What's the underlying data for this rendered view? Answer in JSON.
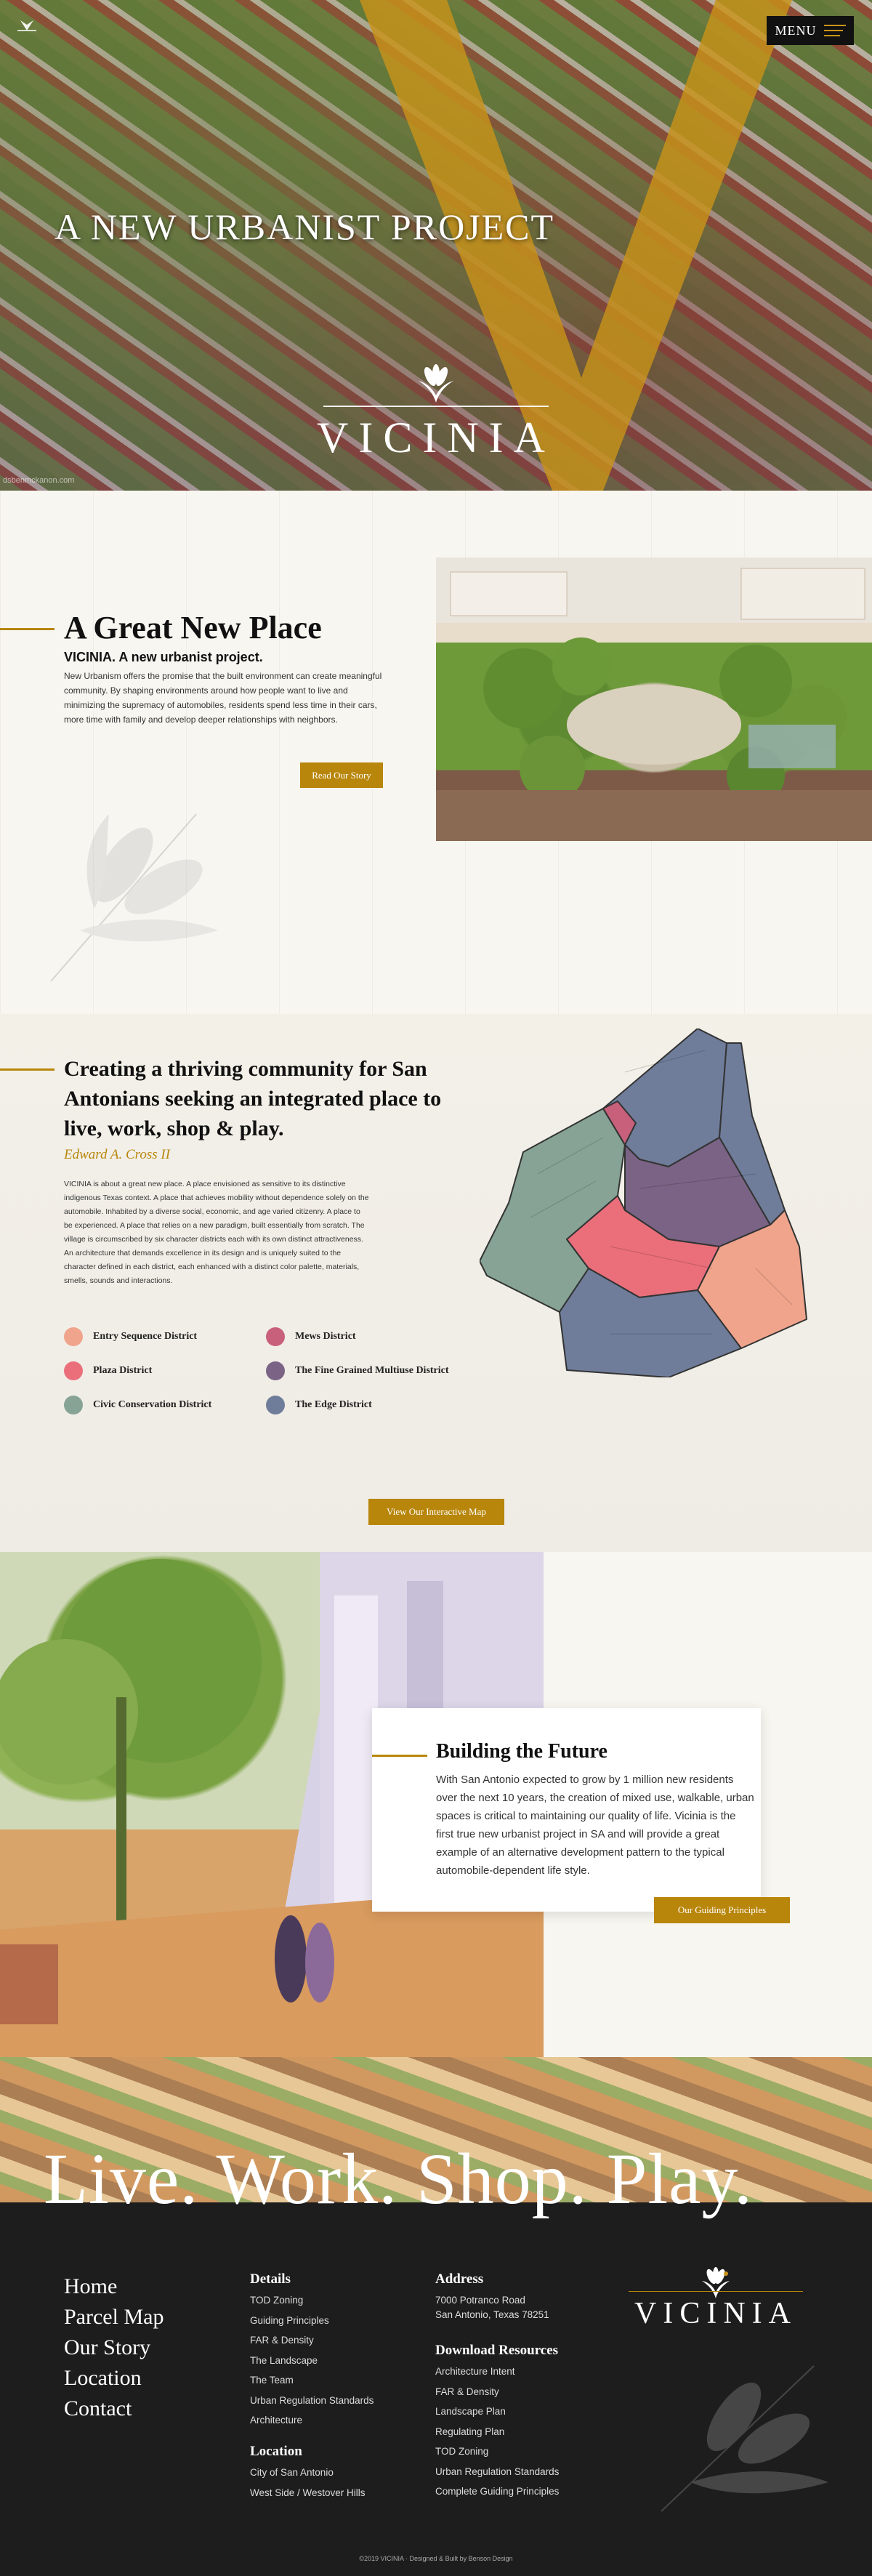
{
  "hero": {
    "title": "A NEW URBANIST PROJECT",
    "logo_text": "VICINIA",
    "menu_label": "MENU",
    "watermark": "dsbenmckanon.com"
  },
  "intro": {
    "title": "A Great New Place",
    "subtitle": "VICINIA. A new urbanist project.",
    "body": "New Urbanism offers the promise that the built environment can create meaningful community. By shaping environments around how people want to live and minimizing the supremacy of automobiles, residents spend less time in their cars, more time with family and develop deeper relationships with neighbors.",
    "button": "Read Our Story"
  },
  "community": {
    "title": "Creating a thriving community for San Antonians seeking an integrated place to live, work, shop & play.",
    "author": "Edward A. Cross II",
    "body": "VICINIA is about a great new place. A place envisioned as sensitive to its distinctive indigenous Texas context. A place that achieves mobility without dependence solely on the automobile. Inhabited by a diverse social, economic, and age varied citizenry. A place to be experienced. A place that relies on a new paradigm, built essentially from scratch. The village is circumscribed by six character districts each with its own distinct attractiveness. An architecture that demands excellence in its design and is uniquely suited to the character defined in each district, each enhanced with a distinct color palette, materials, smells, sounds and interactions.",
    "districts": [
      {
        "label": "Entry Sequence District",
        "color": "#f0a48c"
      },
      {
        "label": "Mews District",
        "color": "#c8607c"
      },
      {
        "label": "Plaza District",
        "color": "#ea6f7b"
      },
      {
        "label": "The Fine Grained Multiuse District",
        "color": "#7a6384"
      },
      {
        "label": "Civic Conservation District",
        "color": "#86a395"
      },
      {
        "label": "The Edge District",
        "color": "#6f7d9a"
      }
    ],
    "button": "View Our Interactive Map"
  },
  "future": {
    "title": "Building the Future",
    "body": "With San Antonio expected to grow by 1 million new residents over the next 10 years, the creation of mixed use, walkable, urban spaces is critical to maintaining our quality of life. Vicinia is the first true new urbanist project in SA and will provide a great example of an alternative development pattern to the typical automobile-dependent life style.",
    "button": "Our Guiding Principles"
  },
  "banner": {
    "text": "Live. Work. Shop. Play."
  },
  "footer": {
    "nav": [
      "Home",
      "Parcel Map",
      "Our Story",
      "Location",
      "Contact"
    ],
    "details_heading": "Details",
    "details": [
      "TOD Zoning",
      "Guiding Principles",
      "FAR & Density",
      "The Landscape",
      "The Team",
      "Urban Regulation Standards",
      "Architecture"
    ],
    "location_heading": "Location",
    "location": [
      "City of San Antonio",
      "West Side / Westover Hills"
    ],
    "address_heading": "Address",
    "address_line1": "7000 Potranco Road",
    "address_line2": "San Antonio, Texas 78251",
    "downloads_heading": "Download Resources",
    "downloads": [
      "Architecture Intent",
      "FAR & Density",
      "Landscape Plan",
      "Regulating Plan",
      "TOD Zoning",
      "Urban Regulation Standards",
      "Complete Guiding Principles"
    ],
    "logo_text": "VICINIA",
    "copyright": "©2019 VICINIA · Designed & Built by Benson Design"
  },
  "colors": {
    "accent": "#b8860b",
    "footer_bg": "#1d1d1d",
    "page_bg": "#f8f6f0"
  }
}
